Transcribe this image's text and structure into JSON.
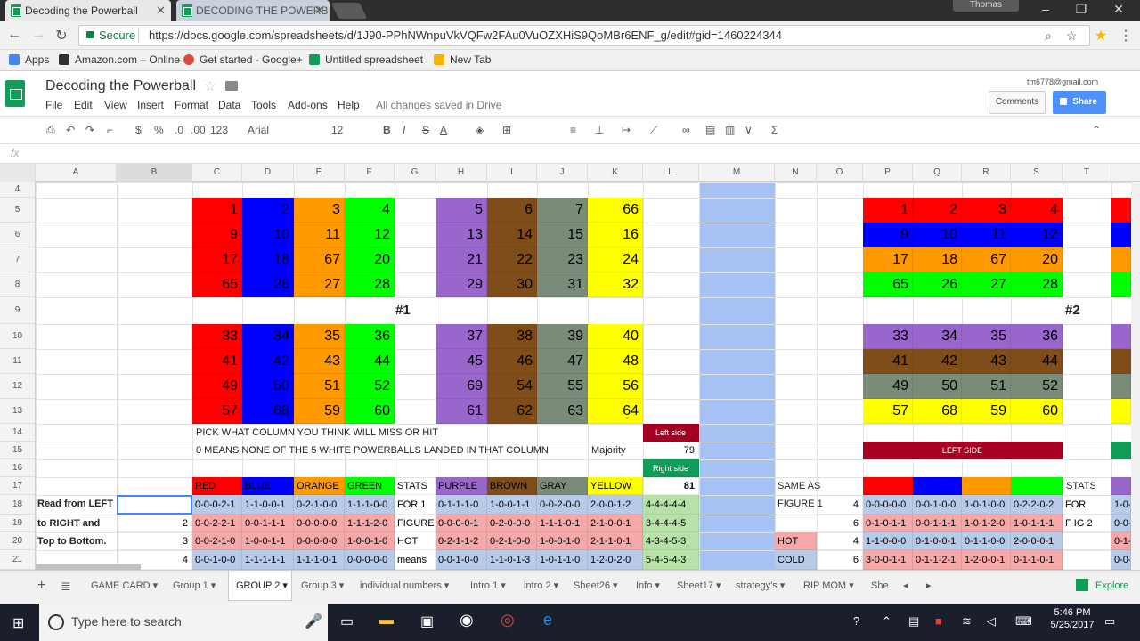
{
  "browser": {
    "tab1": "Decoding the Powerball",
    "tab2": "DECODING THE POWERB",
    "user": "Thomas",
    "url": "https://docs.google.com/spreadsheets/d/1J90-PPhNWnpuVkVQFw2FAu0VuOZXHiS9QoMBr6ENF_g/edit#gid=1460224344",
    "secure": "Secure",
    "bookmarks": [
      "Apps",
      "Amazon.com – Online",
      "Get started - Google+",
      "Untitled spreadsheet",
      "New Tab"
    ]
  },
  "app": {
    "title": "Decoding the Powerball",
    "menus": [
      "File",
      "Edit",
      "View",
      "Insert",
      "Format",
      "Data",
      "Tools",
      "Add-ons",
      "Help"
    ],
    "saved": "All changes saved in Drive",
    "email": "tm6778@gmail.com",
    "comments": "Comments",
    "share": "Share"
  },
  "format": {
    "zoom": "$",
    "pct": "%",
    "dec0": ".0",
    "dec00": ".00",
    "num": "123",
    "font": "Arial",
    "size": "12",
    "bold": "B",
    "italic": "I",
    "strike": "S",
    "color": "A"
  },
  "cols": [
    "A",
    "B",
    "C",
    "D",
    "E",
    "F",
    "G",
    "H",
    "I",
    "J",
    "K",
    "L",
    "M",
    "N",
    "O",
    "P",
    "Q",
    "R",
    "S",
    "T"
  ],
  "rows": [
    "4",
    "5",
    "6",
    "7",
    "8",
    "9",
    "10",
    "11",
    "12",
    "13",
    "14",
    "15",
    "16",
    "17",
    "18",
    "19",
    "20",
    "21"
  ],
  "grid": {
    "left": [
      [
        "1",
        "2",
        "3",
        "4",
        "5",
        "6",
        "7",
        "66"
      ],
      [
        "9",
        "10",
        "11",
        "12",
        "13",
        "14",
        "15",
        "16"
      ],
      [
        "17",
        "18",
        "67",
        "20",
        "21",
        "22",
        "23",
        "24"
      ],
      [
        "65",
        "26",
        "27",
        "28",
        "29",
        "30",
        "31",
        "32"
      ],
      [
        "33",
        "34",
        "35",
        "36",
        "37",
        "38",
        "39",
        "40"
      ],
      [
        "41",
        "42",
        "43",
        "44",
        "45",
        "46",
        "47",
        "48"
      ],
      [
        "49",
        "50",
        "51",
        "52",
        "69",
        "54",
        "55",
        "56"
      ],
      [
        "57",
        "68",
        "59",
        "60",
        "61",
        "62",
        "63",
        "64"
      ]
    ],
    "right": [
      [
        "1",
        "2",
        "3",
        "4"
      ],
      [
        "9",
        "10",
        "11",
        "12"
      ],
      [
        "17",
        "18",
        "67",
        "20"
      ],
      [
        "65",
        "26",
        "27",
        "28"
      ],
      [
        "33",
        "34",
        "35",
        "36"
      ],
      [
        "41",
        "42",
        "43",
        "44"
      ],
      [
        "49",
        "50",
        "51",
        "52"
      ],
      [
        "57",
        "68",
        "59",
        "60"
      ]
    ],
    "marker1": "#1",
    "marker2": "#2",
    "pick": "PICK WHAT COLUMN YOU THINK WILL MISS OR HIT",
    "zero": "0 MEANS NONE OF THE 5 WHITE POWERBALLS LANDED IN THAT COLUMN",
    "majority": "Majority",
    "leftside": "Left side",
    "v79": "79",
    "rightside": "Right side",
    "v81": "81",
    "leftside2": "LEFT SIDE",
    "headers": [
      "RED",
      "BLUE",
      "ORANGE",
      "GREEN",
      "STATS",
      "PURPLE",
      "BROWN",
      "GRAY",
      "YELLOW"
    ],
    "readA": [
      "Read from LEFT",
      "to RIGHT and",
      "Top to Bottom."
    ],
    "readB": [
      "",
      "2",
      "3",
      "4"
    ],
    "rowsC": [
      [
        "0-0-0-2-1",
        "1-1-0-0-1",
        "0-2-1-0-0",
        "1-1-1-0-0",
        "FOR 1",
        "0-1-1-1-0",
        "1-0-0-1-1",
        "0-0-2-0-0",
        "2-0-0-1-2",
        "4-4-4-4-4"
      ],
      [
        "0-0-2-2-1",
        "0-0-1-1-1",
        "0-0-0-0-0",
        "1-1-1-2-0",
        "FIGURE",
        "0-0-0-0-1",
        "0-2-0-0-0",
        "1-1-1-0-1",
        "2-1-0-0-1",
        "3-4-4-4-5"
      ],
      [
        "0-0-2-1-0",
        "1-0-0-1-1",
        "0-0-0-0-0",
        "1-0-0-1-0",
        "HOT",
        "0-2-1-1-2",
        "0-2-1-0-0",
        "1-0-0-1-0",
        "2-1-1-0-1",
        "4-3-4-5-3"
      ],
      [
        "0-0-1-0-0",
        "1-1-1-1-1",
        "1-1-1-0-1",
        "0-0-0-0-0",
        "means",
        "0-0-1-0-0",
        "1-1-0-1-3",
        "1-0-1-1-0",
        "1-2-0-2-0",
        "5-4-5-4-3"
      ]
    ],
    "sameAs": "SAME AS",
    "fig1": "FIGURE 1",
    "hot": "HOT",
    "cold": "COLD",
    "oVals": [
      "4",
      "6",
      "4",
      "6"
    ],
    "rowsP": [
      [
        "0-0-0-0-0",
        "0-0-1-0-0",
        "1-0-1-0-0",
        "0-2-2-0-2",
        "FOR"
      ],
      [
        "0-1-0-1-1",
        "0-0-1-1-1",
        "1-0-1-2-0",
        "1-0-1-1-1",
        "F IG 2"
      ],
      [
        "1-1-0-0-0",
        "0-1-0-0-1",
        "0-1-1-0-0",
        "2-0-0-0-1",
        ""
      ],
      [
        "3-0-0-1-1",
        "0-1-1-2-1",
        "1-2-0-0-1",
        "0-1-1-0-1",
        ""
      ]
    ],
    "stats2": "STATS",
    "uCells": [
      "1-0-",
      "0-0-",
      "0-1-",
      "0-0-"
    ]
  },
  "sheets": [
    "GAME CARD",
    "Group 1",
    "GROUP 2",
    "Group 3",
    "individual numbers",
    "Intro 1",
    "intro 2",
    "Sheet26",
    "Info",
    "Sheet17",
    "strategy's",
    "RIP MOM",
    "She"
  ],
  "explore": "Explore",
  "taskbar": {
    "search": "Type here to search",
    "time": "5:46 PM",
    "date": "5/25/2017"
  },
  "colors": {
    "red": "#ff0000",
    "blue": "#0000ff",
    "orange": "#ff9900",
    "green": "#00ff00",
    "purple": "#9966cc",
    "brown": "#7f4d1a",
    "gray": "#7a8b7a",
    "yellow": "#ffff00",
    "darkred": "#a50021",
    "lightblue": "#a4c2f4",
    "pinkcell": "#f4a8a8",
    "bluecell": "#b7cbe9",
    "greencell": "#b7e1a8"
  }
}
